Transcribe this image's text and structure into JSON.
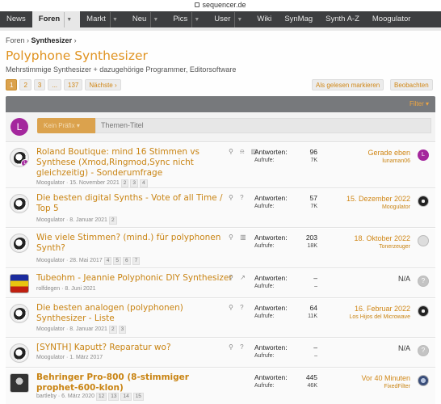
{
  "browser": {
    "url": "sequencer.de"
  },
  "nav": [
    {
      "label": "News"
    },
    {
      "label": "Foren",
      "active": true,
      "caret": "▼"
    },
    {
      "label": "Markt",
      "caret": "▼"
    },
    {
      "label": "Neu",
      "caret": "▼"
    },
    {
      "label": "Pics",
      "caret": "▼"
    },
    {
      "label": "User",
      "caret": "▼"
    },
    {
      "label": "Wiki"
    },
    {
      "label": "SynMag"
    },
    {
      "label": "Synth A-Z"
    },
    {
      "label": "Moogulator"
    }
  ],
  "breadcrumb": {
    "root": "Foren",
    "sep": "›",
    "current": "Synthesizer",
    "sep2": "›"
  },
  "page": {
    "title": "Polyphone Synthesizer",
    "description": "Mehrstimmige Synthesizer + dazugehörige Programmer, Editorsoftware"
  },
  "pager": {
    "pages": [
      "1",
      "2",
      "3",
      "...",
      "137"
    ],
    "next": "Nächste ›"
  },
  "actions": {
    "mark_read": "Als gelesen markieren",
    "watch": "Beobachten",
    "filter": "Filter ▾"
  },
  "new_thread": {
    "avatar_letter": "L",
    "prefix_label": "Kein Präfix ▾",
    "title_placeholder": "Themen-Titel"
  },
  "labels": {
    "answers": "Antworten:",
    "views": "Aufrufe:"
  },
  "threads": [
    {
      "title": "Roland Boutique: mind 16 Stimmen vs Synthese (Xmod,Ringmod,Sync nicht gleichzeitig) - Sonderumfrage",
      "meta": "Moogulator · 15. November 2021",
      "pages": [
        "2",
        "3",
        "4"
      ],
      "icons": "⚲ ⍾ ▥",
      "answers": "96",
      "views": "7K",
      "last_when": "Gerade eben",
      "last_who": "lunaman06"
    },
    {
      "title": "Die besten digital Synths - Vote of all Time / Top 5",
      "meta": "Moogulator · 8. Januar 2021",
      "pages": [
        "2"
      ],
      "icons": "⚲ ?",
      "answers": "57",
      "views": "7K",
      "last_when": "15. Dezember 2022",
      "last_who": "Moogulator"
    },
    {
      "title": "Wie viele Stimmen? (mind.) für polyphonen Synth?",
      "meta": "Moogulator · 28. Mai 2017",
      "pages": [
        "4",
        "5",
        "6",
        "7"
      ],
      "icons": "⚲ ▥",
      "answers": "203",
      "views": "18K",
      "last_when": "18. Oktober 2022",
      "last_who": "Tonerzeuger"
    },
    {
      "title": "Tubeohm - Jeannie Polyphonic DIY Synthesizer",
      "meta": "rolfdegen · 8. Juni 2021",
      "pages": [],
      "icons": "⚲ ↗",
      "answers": "–",
      "views": "–",
      "last_when": "N/A",
      "last_who": ""
    },
    {
      "title": "Die besten analogen (polyphonen) Synthesizer - Liste",
      "meta": "Moogulator · 8. Januar 2021",
      "pages": [
        "2",
        "3"
      ],
      "icons": "⚲ ?",
      "answers": "64",
      "views": "11K",
      "last_when": "16. Februar 2022",
      "last_who": "Los Hijos del Microwave"
    },
    {
      "title": "[SYNTH] Kaputt? Reparatur wo?",
      "meta": "Moogulator · 1. März 2017",
      "pages": [],
      "icons": "⚲ ?",
      "answers": "–",
      "views": "–",
      "last_when": "N/A",
      "last_who": ""
    },
    {
      "title": "Behringer Pro-800 (8-stimmiger prophet-600-klon)",
      "meta": "bartleby · 6. März 2020",
      "pages": [
        "12",
        "13",
        "14",
        "15"
      ],
      "icons": "",
      "answers": "445",
      "views": "46K",
      "last_when": "Vor 40 Minuten",
      "last_who": "FixedFilter"
    }
  ]
}
